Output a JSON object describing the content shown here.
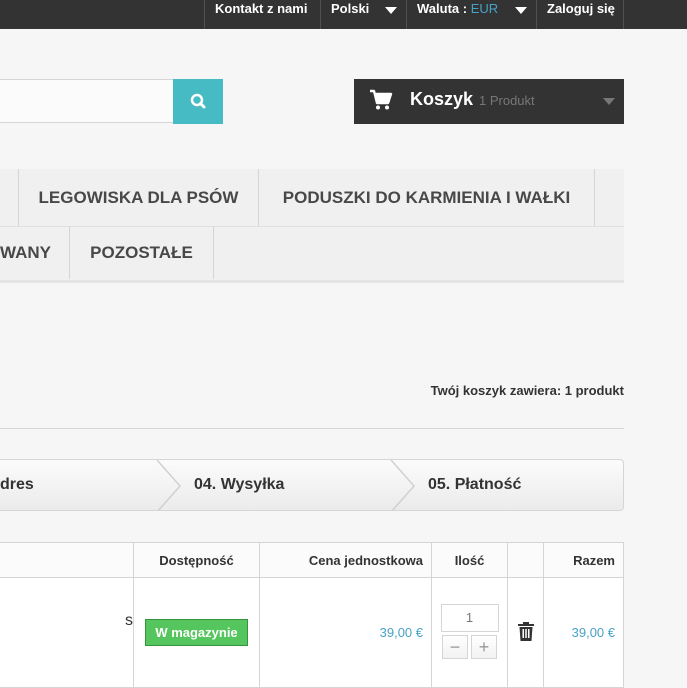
{
  "topbar": {
    "contact": "Kontakt z nami",
    "language": "Polski",
    "currency_label": "Waluta :",
    "currency_value": "EUR",
    "login": "Zaloguj się"
  },
  "cart": {
    "label": "Koszyk",
    "count": "1 Produkt"
  },
  "menu": {
    "row1": [
      "LEGOWISKA DLA PSÓW",
      "PODUSZKI DO KARMIENIA I WAŁKI"
    ],
    "row2": [
      "WANY",
      "POZOSTAŁE"
    ]
  },
  "cart_summary": "Twój koszyk zawiera: 1 produkt",
  "steps": [
    "dres",
    "04. Wysyłka",
    "05. Płatność"
  ],
  "table": {
    "headers": {
      "availability": "Dostępność",
      "unit_price": "Cena jednostkowa",
      "qty": "Ilość",
      "total": "Razem"
    },
    "row": {
      "description_fragment": "s",
      "availability": "W magazynie",
      "unit_price": "39,00 €",
      "qty": "1",
      "total": "39,00 €"
    }
  },
  "colors": {
    "accent": "#46a3c6",
    "search_button": "#46bbc3",
    "in_stock": "#55c65e",
    "topbar": "#333333"
  }
}
